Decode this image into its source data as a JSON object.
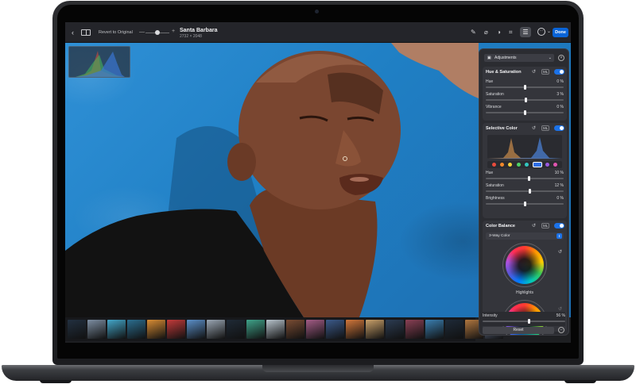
{
  "toolbar": {
    "back_icon": "chevron-left-icon",
    "compare_icon": "split-view-icon",
    "revert_label": "Revert to Original",
    "zoom_minus": "—",
    "zoom_plus": "+",
    "file_name": "Santa Barbara",
    "file_dimensions": "2732 × 2048",
    "tools": [
      "pen-icon",
      "bandage-icon",
      "mask-icon",
      "crop-icon",
      "adjustments-icon",
      "more-icon"
    ],
    "done_label": "Done"
  },
  "panel": {
    "selector_label": "Adjustments",
    "hue_saturation": {
      "title": "Hue & Saturation",
      "ml_label": "ML",
      "sliders": [
        {
          "label": "Hue",
          "value": "0 %",
          "level": 0
        },
        {
          "label": "Saturation",
          "value": "3 %",
          "level": 3
        },
        {
          "label": "Vibrance",
          "value": "0 %",
          "level": 0
        }
      ]
    },
    "selective_color": {
      "title": "Selective Color",
      "ml_label": "ML",
      "swatches": [
        "#e94b3c",
        "#f2882a",
        "#f6d23a",
        "#4fd165",
        "#33c6c0",
        "#2f6fe8",
        "#9b59e0",
        "#e054b0"
      ],
      "selected_swatch_index": 5,
      "sliders": [
        {
          "label": "Hue",
          "value": "10 %",
          "level": 10
        },
        {
          "label": "Saturation",
          "value": "12 %",
          "level": 12
        },
        {
          "label": "Brightness",
          "value": "0 %",
          "level": 0
        }
      ]
    },
    "color_balance": {
      "title": "Color Balance",
      "ml_label": "ML",
      "mode_label": "3-Way Color",
      "wheel_label": "Highlights"
    },
    "intensity": {
      "label": "Intensity",
      "value": "56 %",
      "level": 56
    },
    "reset_label": "Reset"
  },
  "filmstrip": {
    "thumbs": [
      "#223040",
      "#7d8ea2",
      "#43a6c9",
      "#2b6e8f",
      "#d88c34",
      "#c23a3a",
      "#5b8fc8",
      "#9aa6b3",
      "#1f2a36",
      "#3fa38a",
      "#b7c3cc",
      "#7a4c33",
      "#a35c86",
      "#3b5a8a",
      "#d2773a",
      "#c9a06a",
      "#2c3c52",
      "#8a4055",
      "#3a7fb0",
      "#1e2a38",
      "#b0773f",
      "#6f7fa0"
    ]
  }
}
